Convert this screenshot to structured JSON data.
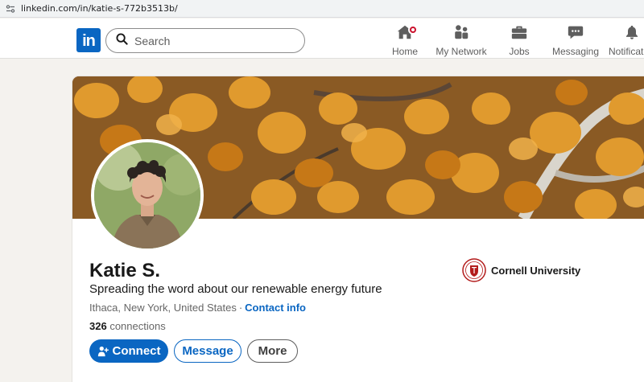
{
  "browser": {
    "url": "linkedin.com/in/katie-s-772b3513b/"
  },
  "navbar": {
    "logo_text": "in",
    "search_placeholder": "Search",
    "items": [
      {
        "label": "Home",
        "icon": "home-icon",
        "has_badge": true
      },
      {
        "label": "My Network",
        "icon": "people-icon"
      },
      {
        "label": "Jobs",
        "icon": "briefcase-icon"
      },
      {
        "label": "Messaging",
        "icon": "chat-icon"
      },
      {
        "label": "Notificati",
        "icon": "bell-icon"
      }
    ]
  },
  "profile": {
    "name": "Katie S.",
    "headline": "Spreading the word about our renewable energy future",
    "location": "Ithaca, New York, United States",
    "separator": "·",
    "contact_info_label": "Contact info",
    "connections_count": "326",
    "connections_label": "connections",
    "education": "Cornell University",
    "actions": {
      "connect_label": "Connect",
      "message_label": "Message",
      "more_label": "More"
    }
  },
  "colors": {
    "brand": "#0a66c2",
    "notification": "#cb112d",
    "cover_accent": "#d98d28",
    "cornell_red": "#b31b1b"
  }
}
